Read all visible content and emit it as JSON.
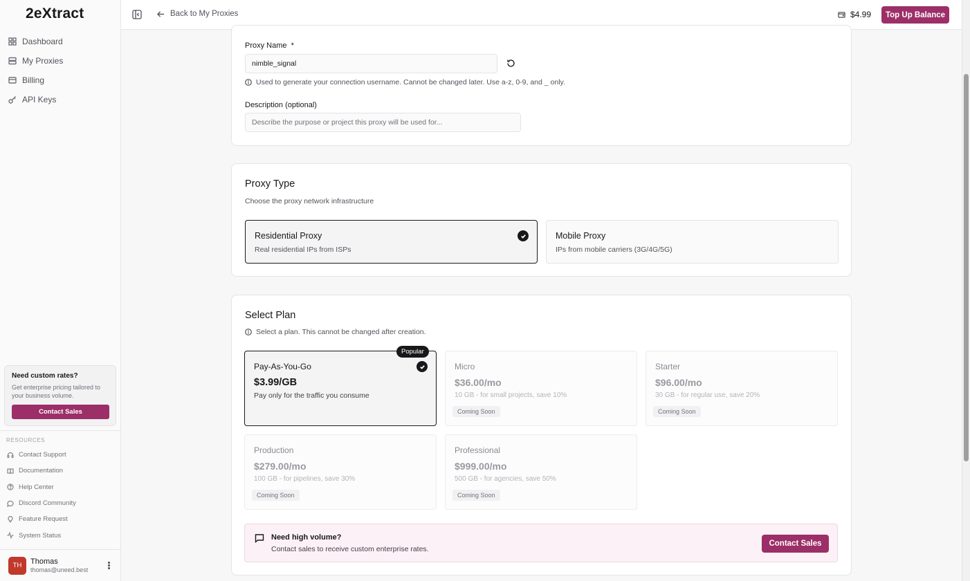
{
  "brand": {
    "logo_pre": "2e",
    "logo_x": "X",
    "logo_post": "tract",
    "accent": "#9c2f67"
  },
  "sidebar": {
    "items": [
      {
        "label": "Dashboard",
        "icon": "grid-icon"
      },
      {
        "label": "My Proxies",
        "icon": "server-icon"
      },
      {
        "label": "Billing",
        "icon": "card-icon"
      },
      {
        "label": "API Keys",
        "icon": "key-icon"
      }
    ],
    "promo": {
      "title": "Need custom rates?",
      "text": "Get enterprise pricing tailored to your business volume.",
      "button": "Contact Sales"
    },
    "resources_title": "RESOURCES",
    "resources": [
      {
        "label": "Contact Support",
        "icon": "headset-icon"
      },
      {
        "label": "Documentation",
        "icon": "book-icon"
      },
      {
        "label": "Help Center",
        "icon": "help-icon"
      },
      {
        "label": "Discord Community",
        "icon": "chat-icon"
      },
      {
        "label": "Feature Request",
        "icon": "bulb-icon"
      },
      {
        "label": "System Status",
        "icon": "activity-icon"
      }
    ],
    "user": {
      "initials": "TH",
      "name": "Thomas",
      "email": "thomas@uneed.best"
    }
  },
  "header": {
    "back_label": "Back to My Proxies",
    "balance": "$4.99",
    "topup_label": "Top Up Balance"
  },
  "form": {
    "proxy_name_label": "Proxy Name",
    "required_mark": "*",
    "proxy_name_value": "nimble_signal",
    "proxy_name_hint": "Used to generate your connection username. Cannot be changed later. Use a-z, 0-9, and _ only.",
    "description_label": "Description (optional)",
    "description_placeholder": "Describe the purpose or project this proxy will be used for..."
  },
  "proxy_type": {
    "title": "Proxy Type",
    "subtitle": "Choose the proxy network infrastructure",
    "options": [
      {
        "title": "Residential Proxy",
        "desc": "Real residential IPs from ISPs",
        "selected": true
      },
      {
        "title": "Mobile Proxy",
        "desc": "IPs from mobile carriers (3G/4G/5G)",
        "selected": false
      }
    ]
  },
  "plans": {
    "title": "Select Plan",
    "hint": "Select a plan. This cannot be changed after creation.",
    "popular_badge": "Popular",
    "items": [
      {
        "name": "Pay-As-You-Go",
        "price": "$3.99/GB",
        "desc": "Pay only for the traffic you consume",
        "selected": true,
        "badge": ""
      },
      {
        "name": "Micro",
        "price": "$36.00/mo",
        "desc": "10 GB - for small projects, save 10%",
        "selected": false,
        "badge": "Coming Soon"
      },
      {
        "name": "Starter",
        "price": "$96.00/mo",
        "desc": "30 GB - for regular use, save 20%",
        "selected": false,
        "badge": "Coming Soon"
      },
      {
        "name": "Production",
        "price": "$279.00/mo",
        "desc": "100 GB - for pipelines, save 30%",
        "selected": false,
        "badge": "Coming Soon"
      },
      {
        "name": "Professional",
        "price": "$999.00/mo",
        "desc": "500 GB - for agencies, save 50%",
        "selected": false,
        "badge": "Coming Soon"
      }
    ]
  },
  "volume": {
    "title": "Need high volume?",
    "text": "Contact sales to receive custom enterprise rates.",
    "button": "Contact Sales"
  }
}
